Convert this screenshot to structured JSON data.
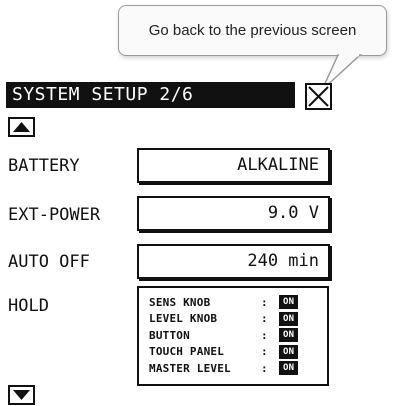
{
  "callout": {
    "text": "Go back to the previous screen"
  },
  "screen": {
    "title": "SYSTEM SETUP 2/6",
    "close_icon": "close-icon",
    "scroll_up_icon": "arrow-up-icon",
    "scroll_down_icon": "arrow-down-icon"
  },
  "settings": {
    "battery": {
      "label": "BATTERY",
      "value": "ALKALINE"
    },
    "ext_power": {
      "label": "EXT-POWER",
      "value": "9.0 V"
    },
    "auto_off": {
      "label": "AUTO OFF",
      "value": "240 min"
    },
    "hold": {
      "label": "HOLD",
      "items": [
        {
          "name": "SENS KNOB",
          "colon": ":",
          "state": "ON"
        },
        {
          "name": "LEVEL KNOB",
          "colon": ":",
          "state": "ON"
        },
        {
          "name": "BUTTON",
          "colon": ":",
          "state": "ON"
        },
        {
          "name": "TOUCH PANEL",
          "colon": ":",
          "state": "ON"
        },
        {
          "name": "MASTER LEVEL",
          "colon": ":",
          "state": "ON"
        }
      ]
    }
  }
}
